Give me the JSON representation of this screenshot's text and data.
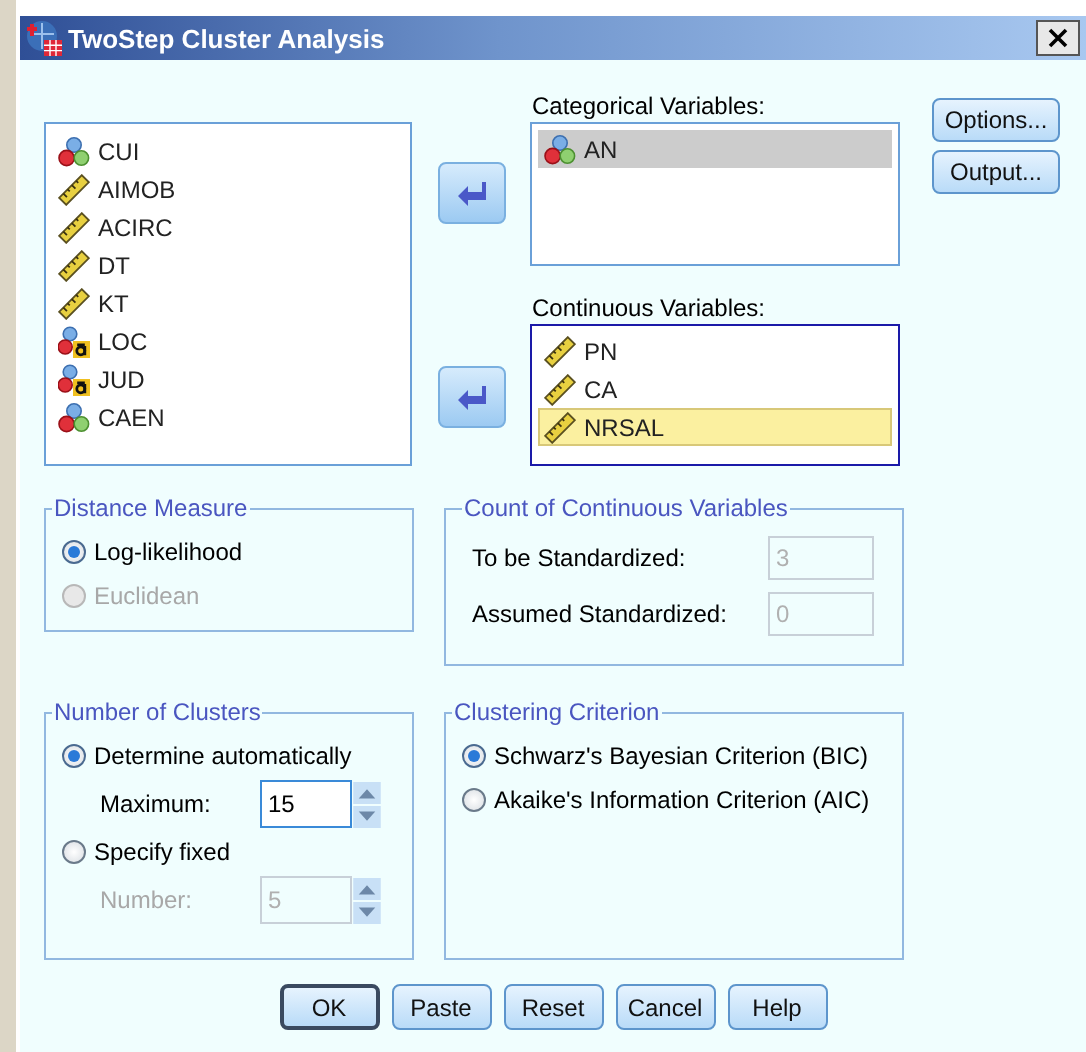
{
  "window": {
    "title": "TwoStep Cluster Analysis"
  },
  "source_list": {
    "items": [
      {
        "name": "CUI",
        "kind": "nominal"
      },
      {
        "name": "AIMOB",
        "kind": "scale"
      },
      {
        "name": "ACIRC",
        "kind": "scale"
      },
      {
        "name": "DT",
        "kind": "scale"
      },
      {
        "name": "KT",
        "kind": "scale"
      },
      {
        "name": "LOC",
        "kind": "string"
      },
      {
        "name": "JUD",
        "kind": "string"
      },
      {
        "name": "CAEN",
        "kind": "nominal"
      }
    ]
  },
  "categorical": {
    "label": "Categorical Variables:",
    "focused": false,
    "items": [
      {
        "name": "AN",
        "kind": "nominal",
        "selected": true
      }
    ]
  },
  "continuous": {
    "label": "Continuous Variables:",
    "focused": true,
    "items": [
      {
        "name": "PN",
        "kind": "scale",
        "selected": false
      },
      {
        "name": "CA",
        "kind": "scale",
        "selected": false
      },
      {
        "name": "NRSAL",
        "kind": "scale",
        "selected": true
      }
    ]
  },
  "side_buttons": [
    "Options...",
    "Output..."
  ],
  "distance_measure": {
    "title": "Distance Measure",
    "options": [
      {
        "label": "Log-likelihood",
        "selected": true,
        "disabled": false
      },
      {
        "label": "Euclidean",
        "selected": false,
        "disabled": true
      }
    ]
  },
  "count_continuous": {
    "title": "Count of Continuous Variables",
    "fields": [
      {
        "label": "To be Standardized:",
        "value": "3",
        "disabled": true
      },
      {
        "label": "Assumed Standardized:",
        "value": "0",
        "disabled": true
      }
    ]
  },
  "number_of_clusters": {
    "title": "Number of Clusters",
    "options": [
      {
        "label": "Determine automatically",
        "selected": true,
        "disabled": false,
        "spinner": {
          "label": "Maximum:",
          "value": "15",
          "disabled": false
        }
      },
      {
        "label": "Specify fixed",
        "selected": false,
        "disabled": false,
        "spinner": {
          "label": "Number:",
          "value": "5",
          "disabled": true
        }
      }
    ]
  },
  "clustering_criterion": {
    "title": "Clustering Criterion",
    "options": [
      {
        "label": "Schwarz's Bayesian Criterion (BIC)",
        "selected": true,
        "disabled": false
      },
      {
        "label": "Akaike's Information Criterion (AIC)",
        "selected": false,
        "disabled": false
      }
    ]
  },
  "buttons": [
    {
      "label": "OK",
      "default": true
    },
    {
      "label": "Paste",
      "default": false
    },
    {
      "label": "Reset",
      "default": false
    },
    {
      "label": "Cancel",
      "default": false
    },
    {
      "label": "Help",
      "default": false
    }
  ]
}
